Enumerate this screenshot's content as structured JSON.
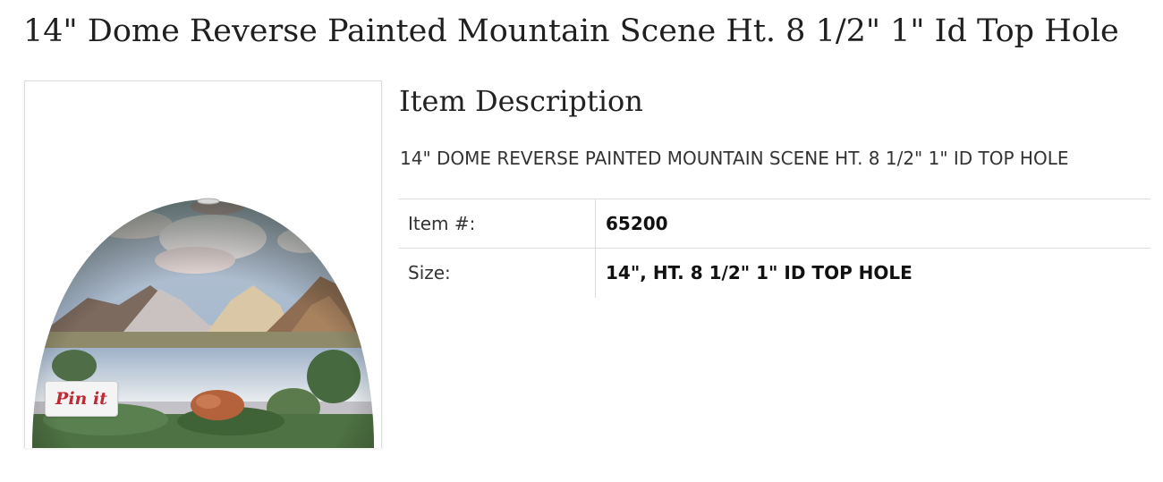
{
  "product": {
    "title": "14\" Dome Reverse Painted Mountain Scene Ht. 8 1/2\" 1\" Id Top Hole"
  },
  "image": {
    "pin_button_label": "Pin it"
  },
  "description": {
    "heading": "Item Description",
    "text": "14\" DOME REVERSE PAINTED MOUNTAIN SCENE HT. 8 1/2\" 1\" ID TOP HOLE"
  },
  "specs": [
    {
      "label": "Item #:",
      "value": "65200"
    },
    {
      "label": "Size:",
      "value": "14\", HT. 8 1/2\" 1\" ID TOP HOLE"
    }
  ],
  "colors": {
    "pin_red": "#bd2a35",
    "border": "#dddddd",
    "text": "#222222"
  }
}
